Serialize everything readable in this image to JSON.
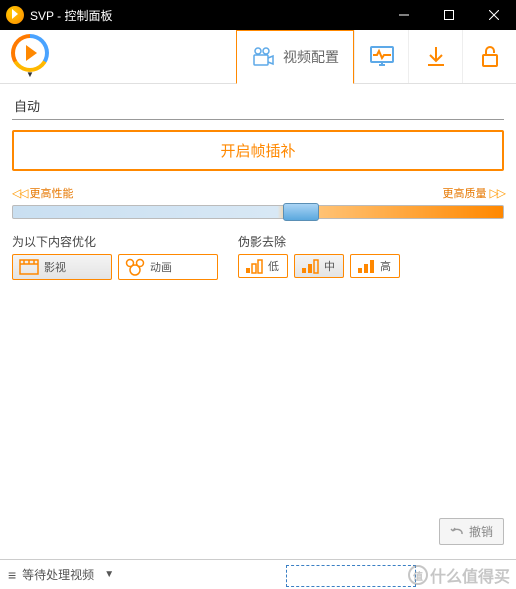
{
  "titlebar": {
    "title": "SVP - 控制面板"
  },
  "tabs": {
    "video_config": "视频配置"
  },
  "profile": {
    "current": "自动"
  },
  "main_button": {
    "label": "开启帧插补"
  },
  "slider": {
    "left_label": "更高性能",
    "right_label": "更高质量"
  },
  "optimize": {
    "title": "为以下内容优化",
    "movie": "影视",
    "anime": "动画"
  },
  "artifact": {
    "title": "伪影去除",
    "low": "低",
    "mid": "中",
    "high": "高"
  },
  "undo": {
    "label": "撤销"
  },
  "status": {
    "text": "等待处理视频"
  },
  "watermark": {
    "text": "什么值得买",
    "icon": "值"
  }
}
